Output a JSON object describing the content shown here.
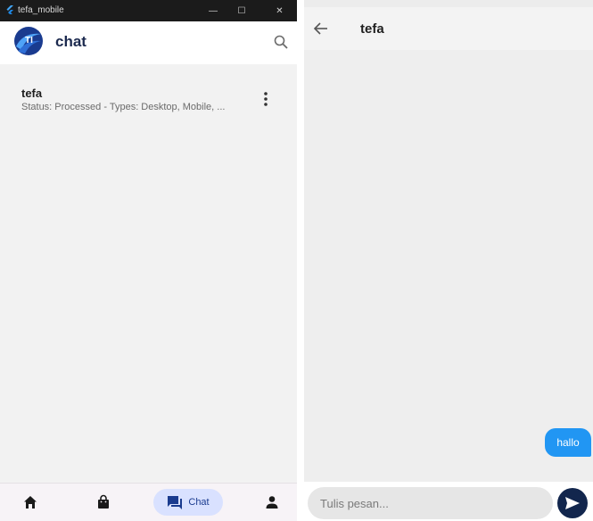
{
  "window": {
    "title": "tefa_mobile",
    "minimize": "—",
    "maximize": "☐",
    "close": "✕"
  },
  "appbar": {
    "logo_text": "TI",
    "title": "chat",
    "search_icon": "search-icon"
  },
  "chat_list": [
    {
      "name": "tefa",
      "status": "Status: Processed - Types: Desktop, Mobile, ...",
      "menu_icon": "more-vertical-icon"
    }
  ],
  "bottom_nav": {
    "items": [
      {
        "icon": "home-icon"
      },
      {
        "icon": "shopping-bag-icon"
      },
      {
        "icon": "chat-icon",
        "label": "Chat",
        "active": true
      },
      {
        "icon": "person-icon"
      }
    ]
  },
  "conversation": {
    "title": "tefa",
    "back_icon": "arrow-left-icon",
    "messages": [
      {
        "text": "hallo",
        "from": "me"
      }
    ],
    "input_placeholder": "Tulis pesan...",
    "send_icon": "send-icon"
  },
  "colors": {
    "brand_dark": "#12264d",
    "brand_blue": "#1a3b8f",
    "bubble": "#2196f3",
    "nav_active_bg": "#d9e1ff"
  }
}
